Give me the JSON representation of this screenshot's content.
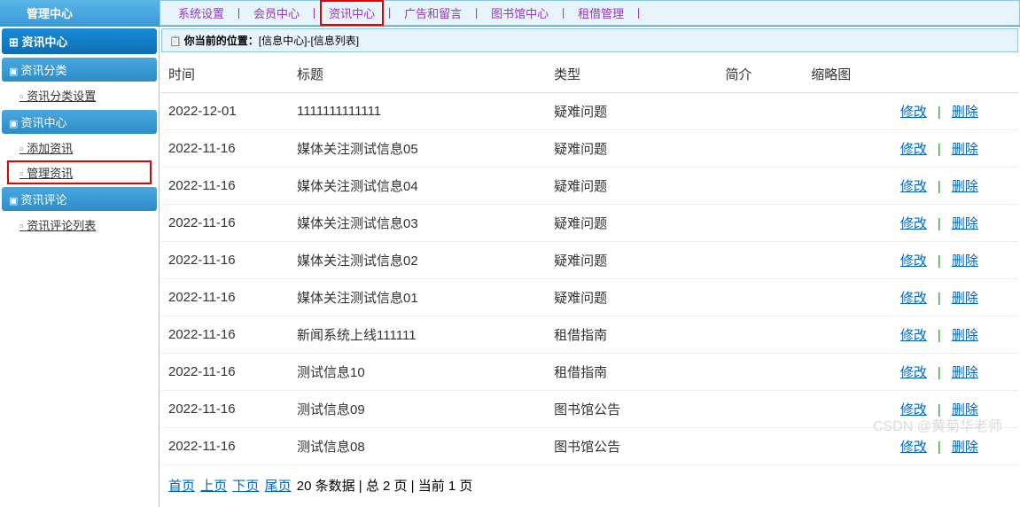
{
  "topbar": {
    "title": "管理中心",
    "nav": [
      "系统设置",
      "会员中心",
      "资讯中心",
      "广告和留言",
      "图书馆中心",
      "租借管理"
    ],
    "highlighted_index": 2
  },
  "sidebar": {
    "header": "资讯中心",
    "sections": [
      {
        "title": "资讯分类",
        "items": [
          {
            "label": "资讯分类设置",
            "highlighted": false
          }
        ]
      },
      {
        "title": "资讯中心",
        "items": [
          {
            "label": "添加资讯",
            "highlighted": false
          },
          {
            "label": "管理资讯",
            "highlighted": true
          }
        ]
      },
      {
        "title": "资讯评论",
        "items": [
          {
            "label": "资讯评论列表",
            "highlighted": false
          }
        ]
      }
    ]
  },
  "breadcrumb": {
    "prefix": "你当前的位置：",
    "path": "[信息中心]-[信息列表]"
  },
  "table": {
    "headers": [
      "时间",
      "标题",
      "类型",
      "简介",
      "缩略图",
      ""
    ],
    "rows": [
      {
        "time": "2022-12-01",
        "title": "1111111111111",
        "type": "疑难问题",
        "intro": "",
        "thumb": ""
      },
      {
        "time": "2022-11-16",
        "title": "媒体关注测试信息05",
        "type": "疑难问题",
        "intro": "",
        "thumb": ""
      },
      {
        "time": "2022-11-16",
        "title": "媒体关注测试信息04",
        "type": "疑难问题",
        "intro": "",
        "thumb": ""
      },
      {
        "time": "2022-11-16",
        "title": "媒体关注测试信息03",
        "type": "疑难问题",
        "intro": "",
        "thumb": ""
      },
      {
        "time": "2022-11-16",
        "title": "媒体关注测试信息02",
        "type": "疑难问题",
        "intro": "",
        "thumb": ""
      },
      {
        "time": "2022-11-16",
        "title": "媒体关注测试信息01",
        "type": "疑难问题",
        "intro": "",
        "thumb": ""
      },
      {
        "time": "2022-11-16",
        "title": "新闻系统上线111111",
        "type": "租借指南",
        "intro": "",
        "thumb": ""
      },
      {
        "time": "2022-11-16",
        "title": "测试信息10",
        "type": "租借指南",
        "intro": "",
        "thumb": ""
      },
      {
        "time": "2022-11-16",
        "title": "测试信息09",
        "type": "图书馆公告",
        "intro": "",
        "thumb": ""
      },
      {
        "time": "2022-11-16",
        "title": "测试信息08",
        "type": "图书馆公告",
        "intro": "",
        "thumb": ""
      }
    ],
    "actions": {
      "edit": "修改",
      "delete": "删除"
    }
  },
  "pagination": {
    "first": "首页",
    "prev": "上页",
    "next": "下页",
    "last": "尾页",
    "summary": "20 条数据 | 总 2 页 | 当前 1 页"
  },
  "watermark": "CSDN @黄菊华老师"
}
